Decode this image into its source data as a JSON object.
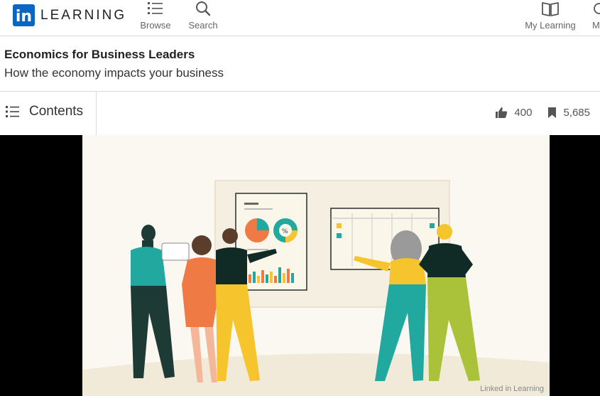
{
  "brand": {
    "logo_mark": "in",
    "name": "LEARNING"
  },
  "nav": {
    "browse_label": "Browse",
    "search_label": "Search",
    "my_learning_label": "My Learning",
    "me_label": "M"
  },
  "course": {
    "title": "Economics for Business Leaders",
    "subtitle": "How the economy impacts your business"
  },
  "contents": {
    "label": "Contents"
  },
  "stats": {
    "likes": "400",
    "saves": "5,685"
  },
  "video": {
    "watermark": "Linked in Learning"
  },
  "colors": {
    "brand_blue": "#0a66c2",
    "teal": "#21a9a0",
    "orange": "#ef7a43",
    "yellow": "#f6c42d",
    "green": "#a9c23a"
  }
}
